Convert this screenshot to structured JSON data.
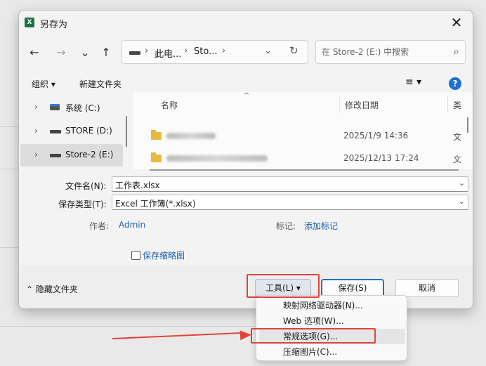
{
  "window": {
    "title": "另存为",
    "app_icon_letter": "X",
    "close_glyph": "✕"
  },
  "nav": {
    "back_glyph": "←",
    "forward_glyph": "→",
    "recent_glyph": "⌄",
    "up_glyph": "↑",
    "address_segments": [
      "此电...",
      "Sto..."
    ],
    "address_sep": "›",
    "address_dropdown_glyph": "⌄",
    "refresh_glyph": "↻",
    "search_placeholder": "在 Store-2 (E:) 中搜索",
    "search_glyph": "⌕"
  },
  "commands": {
    "organize": "组织 ▾",
    "new_folder": "新建文件夹",
    "view_glyph": "≡ ▾",
    "help_glyph": "?"
  },
  "tree": [
    {
      "label": "系统 (C:)",
      "icon": "windows-drive-icon",
      "selected": false
    },
    {
      "label": "STORE (D:)",
      "icon": "drive-icon",
      "selected": false
    },
    {
      "label": "Store-2 (E:)",
      "icon": "drive-icon",
      "selected": true
    }
  ],
  "tree_chevron": "›",
  "file_list": {
    "columns": {
      "name": "名称",
      "modified": "修改日期",
      "type": "类"
    },
    "sort_indicator": "^",
    "rows": [
      {
        "name_blurred": true,
        "modified": "2025/1/9 14:36",
        "type": "文"
      },
      {
        "name_blurred": true,
        "modified": "2025/12/13 17:24",
        "type": "文"
      }
    ]
  },
  "form": {
    "filename_label": "文件名(N):",
    "filename_value": "工作表.xlsx",
    "filetype_label": "保存类型(T):",
    "filetype_value": "Excel 工作簿(*.xlsx)",
    "author_label": "作者:",
    "author_value": "Admin",
    "tags_label": "标记:",
    "tags_value": "添加标记",
    "thumbnail_label": "保存缩略图",
    "dropdown_glyph": "⌄"
  },
  "footer": {
    "hide_folders": "⌃ 隐藏文件夹",
    "tools": "工具(L)  ▾",
    "save": "保存(S)",
    "cancel": "取消"
  },
  "tools_menu": [
    {
      "label": "映射网络驱动器(N)..."
    },
    {
      "label": "Web 选项(W)..."
    },
    {
      "label": "常规选项(G)...",
      "highlighted": true
    },
    {
      "label": "压缩图片(C)..."
    }
  ],
  "colors": {
    "accent": "#1e6fd0",
    "annotation": "#e0443a",
    "link": "#1f5fad"
  }
}
